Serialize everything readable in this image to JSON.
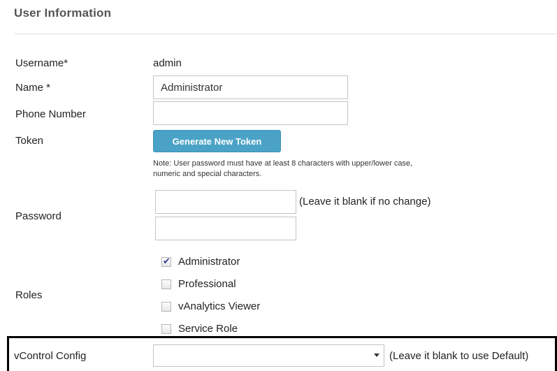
{
  "section": {
    "title": "User Information"
  },
  "fields": {
    "username": {
      "label": "Username*",
      "value": "admin"
    },
    "name": {
      "label": "Name *",
      "value": "Administrator"
    },
    "phone": {
      "label": "Phone Number",
      "value": ""
    },
    "token": {
      "label": "Token",
      "button_label": "Generate New Token"
    },
    "password": {
      "label": "Password",
      "note": "Note: User password must have at least 8 characters with upper/lower case, numeric and special characters.",
      "hint": "(Leave it blank if no change)",
      "value": "",
      "confirm_value": ""
    },
    "roles": {
      "label": "Roles",
      "options": [
        {
          "label": "Administrator",
          "checked": true
        },
        {
          "label": "Professional",
          "checked": false
        },
        {
          "label": "vAnalytics Viewer",
          "checked": false
        },
        {
          "label": "Service Role",
          "checked": false
        }
      ]
    },
    "vcontrol": {
      "label": "vControl Config",
      "selected": "",
      "hint": "(Leave it blank to use Default)"
    }
  },
  "colors": {
    "button": "#4aa3c7",
    "highlight_border": "#000000"
  }
}
